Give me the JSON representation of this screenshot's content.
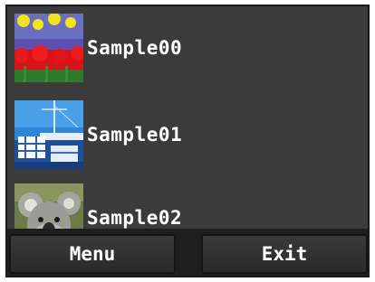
{
  "files": [
    {
      "name": "Sample00",
      "thumbnail": "tulips-thumbnail"
    },
    {
      "name": "Sample01",
      "thumbnail": "ship-deck-thumbnail"
    },
    {
      "name": "Sample02",
      "thumbnail": "koala-thumbnail"
    }
  ],
  "buttons": {
    "menu_label": "Menu",
    "exit_label": "Exit"
  },
  "colors": {
    "screen_background": "#3b3b3b",
    "bottom_bar": "#1e1e1e",
    "text": "#ffffff"
  }
}
